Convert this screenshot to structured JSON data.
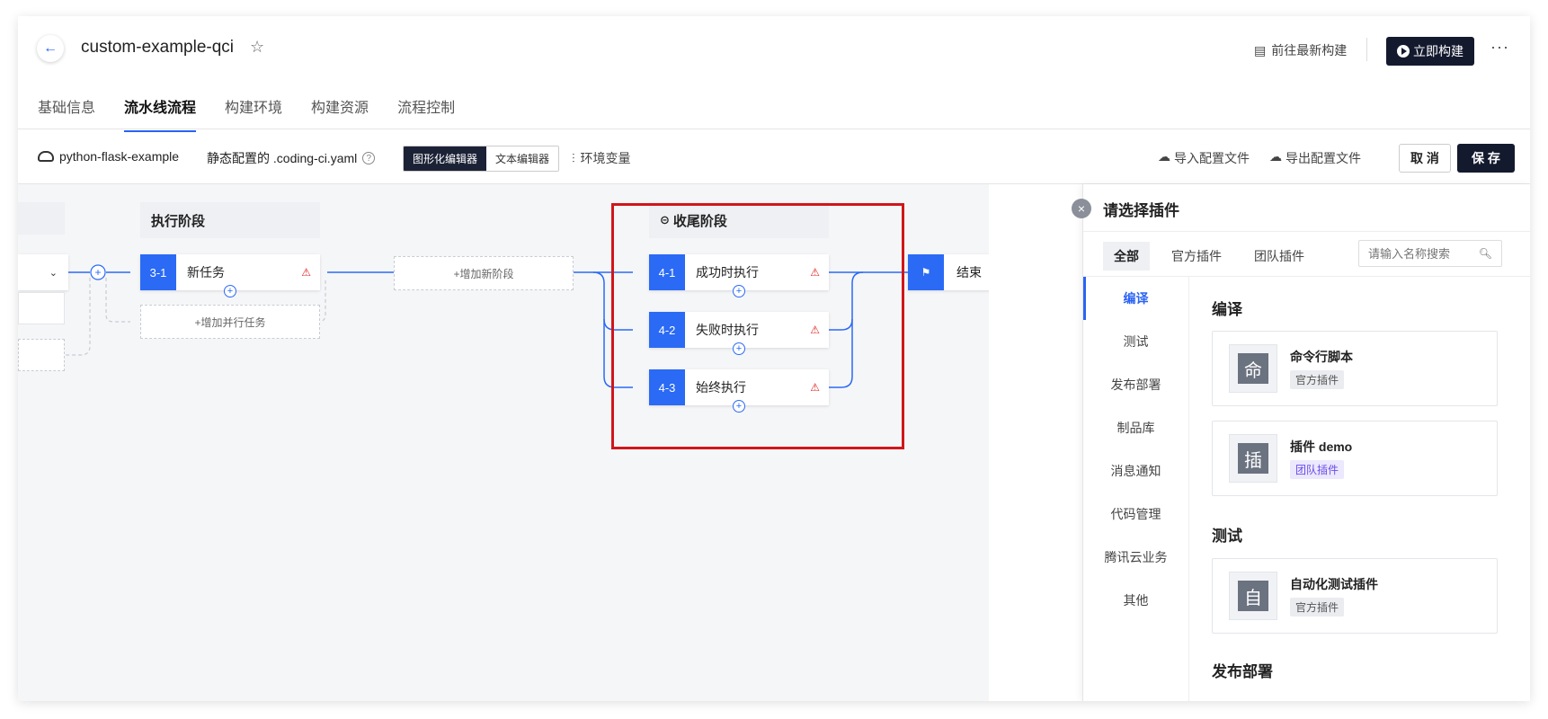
{
  "header": {
    "title": "custom-example-qci",
    "goto_latest": "前往最新构建",
    "build_now": "立即构建",
    "more": "···"
  },
  "tabs": [
    {
      "label": "基础信息"
    },
    {
      "label": "流水线流程"
    },
    {
      "label": "构建环境"
    },
    {
      "label": "构建资源"
    },
    {
      "label": "流程控制"
    }
  ],
  "toolbar": {
    "repo": "python-flask-example",
    "static_config": "静态配置的 .coding-ci.yaml",
    "graphic_editor": "图形化编辑器",
    "text_editor": "文本编辑器",
    "env_vars": "环境变量",
    "import": "导入配置文件",
    "export": "导出配置文件",
    "cancel": "取 消",
    "save": "保 存"
  },
  "pipeline": {
    "exec_stage": {
      "title": "执行阶段",
      "task": {
        "num": "3-1",
        "label": "新任务"
      },
      "add_parallel": "+增加并行任务"
    },
    "add_stage": "+增加新阶段",
    "final_stage": {
      "title": "收尾阶段",
      "tasks": [
        {
          "num": "4-1",
          "label": "成功时执行"
        },
        {
          "num": "4-2",
          "label": "失败时执行"
        },
        {
          "num": "4-3",
          "label": "始终执行"
        }
      ]
    },
    "end": "结束"
  },
  "plugin_panel": {
    "title": "请选择插件",
    "tabs": [
      "全部",
      "官方插件",
      "团队插件"
    ],
    "search_placeholder": "请输入名称搜索",
    "categories": [
      "编译",
      "测试",
      "发布部署",
      "制品库",
      "消息通知",
      "代码管理",
      "腾讯云业务",
      "其他"
    ],
    "sections": [
      {
        "title": "编译",
        "plugins": [
          {
            "icon_char": "命",
            "name": "命令行脚本",
            "tag": "官方插件"
          },
          {
            "icon_char": "插",
            "name": "插件 demo",
            "tag": "团队插件"
          }
        ]
      },
      {
        "title": "测试",
        "plugins": [
          {
            "icon_char": "自",
            "name": "自动化测试插件",
            "tag": "官方插件"
          }
        ]
      },
      {
        "title": "发布部署",
        "plugins": []
      }
    ]
  },
  "colors": {
    "accent": "#2a6af5",
    "dark_button": "#141a2e",
    "highlight": "#d0161b",
    "warning": "#e02020"
  }
}
